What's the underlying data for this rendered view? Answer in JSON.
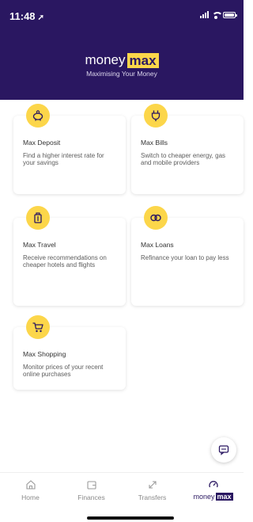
{
  "status_bar": {
    "time": "11:48",
    "arrow": "➚"
  },
  "header": {
    "brand_word": "money",
    "brand_badge": "max",
    "tagline": "Maximising Your Money"
  },
  "colors": {
    "header_bg": "#2a1761",
    "accent": "#fcd64a"
  },
  "cards": [
    {
      "title": "Max Deposit",
      "description": "Find a higher interest rate for your savings",
      "icon": "piggy-bank-icon"
    },
    {
      "title": "Max Bills",
      "description": "Switch to cheaper energy, gas and mobile providers",
      "icon": "plug-icon"
    },
    {
      "title": "Max Travel",
      "description": "Receive recommendations on cheaper hotels and flights",
      "icon": "luggage-icon"
    },
    {
      "title": "Max Loans",
      "description": "Refinance your loan to pay less",
      "icon": "loan-icon"
    },
    {
      "title": "Max Shopping",
      "description": "Monitor prices of your recent online purchases",
      "icon": "shopping-cart-icon"
    }
  ],
  "chat": {
    "icon": "chat-icon"
  },
  "tabs": [
    {
      "label": "Home",
      "icon": "home-icon"
    },
    {
      "label": "Finances",
      "icon": "wallet-icon"
    },
    {
      "label": "Transfers",
      "icon": "transfer-icon"
    },
    {
      "label_money": "money",
      "label_max": "max",
      "icon": "gauge-icon",
      "active": true
    }
  ]
}
